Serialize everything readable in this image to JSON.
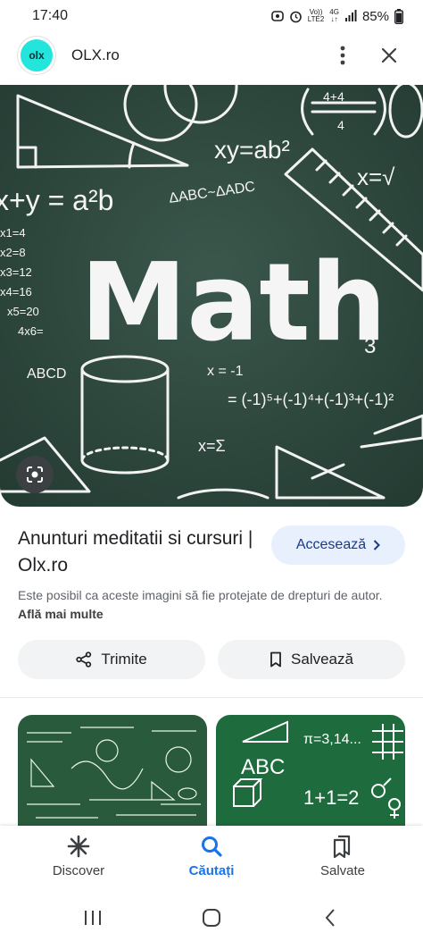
{
  "status": {
    "time": "17:40",
    "volte_top": "Vo))",
    "volte_bottom": "LTE2",
    "network_top": "4G",
    "network_bottom": "↓↑",
    "battery": "85%"
  },
  "header": {
    "logo_text": "olx",
    "site_name": "OLX.ro"
  },
  "hero": {
    "chalk_eq1": "xy=ab²",
    "chalk_eq2": "x+y = a²b",
    "chalk_word": "Math",
    "chalk_tri": "ΔABC~ΔADC",
    "chalk_frac1": "4+4",
    "chalk_frac2": "4",
    "chalk_xeq": "x=√",
    "chalk_times": [
      "x1=4",
      "x2=8",
      "x3=12",
      "x4=16",
      "x5=20",
      "4x6="
    ],
    "chalk_series": "= (-1)⁵+(-1)⁴+(-1)³+(-1)²",
    "chalk_xm1": "x = -1",
    "chalk_sum": "x=Σ",
    "chalk_abcd": "ABCD",
    "chalk_three": "3"
  },
  "result": {
    "title": "Anunturi meditatii si cursuri | Olx.ro",
    "access_label": "Accesează",
    "notice_text": "Este posibil ca aceste imagini să fie protejate de drepturi de autor.",
    "notice_link": "Află mai multe",
    "share_label": "Trimite",
    "save_label": "Salvează"
  },
  "thumbs": {
    "right_abc": "ABC",
    "right_eq": "1+1=2",
    "right_pi": "π=3,14..."
  },
  "bottom_nav": [
    {
      "label": "Discover",
      "icon": "asterisk-icon",
      "active": false
    },
    {
      "label": "Căutați",
      "icon": "search-icon",
      "active": true
    },
    {
      "label": "Salvate",
      "icon": "bookmarks-icon",
      "active": false
    }
  ],
  "colors": {
    "accent": "#1a73e8",
    "chalkboard": "#2f4a40",
    "logo_bg": "#23e5db",
    "access_bg": "#e8f0fe"
  }
}
